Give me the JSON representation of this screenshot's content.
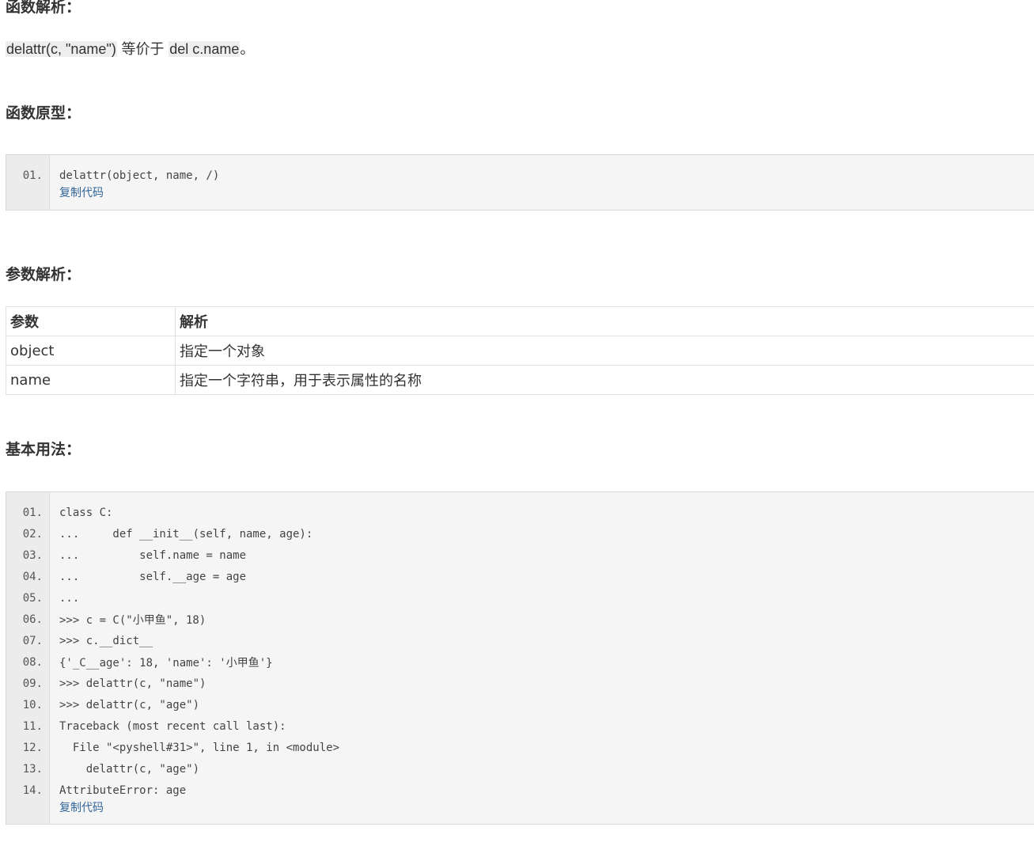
{
  "sections": {
    "analysis_heading": "函数解析：",
    "prototype_heading": "函数原型：",
    "params_heading": "参数解析：",
    "usage_heading": "基本用法："
  },
  "analysis": {
    "code1": "delattr(c, \"name\")",
    "middle": " 等价于 ",
    "code2": "del c.name",
    "end": "。"
  },
  "prototype_code": {
    "lines": [
      {
        "num": "01.",
        "text": "delattr(object, name, /)"
      }
    ],
    "copy_label": "复制代码"
  },
  "params_table": {
    "headers": [
      "参数",
      "解析"
    ],
    "rows": [
      [
        "object",
        "指定一个对象"
      ],
      [
        "name",
        "指定一个字符串，用于表示属性的名称"
      ]
    ]
  },
  "usage_code": {
    "lines": [
      {
        "num": "01.",
        "text": "class C:"
      },
      {
        "num": "02.",
        "text": "...     def __init__(self, name, age):"
      },
      {
        "num": "03.",
        "text": "...         self.name = name"
      },
      {
        "num": "04.",
        "text": "...         self.__age = age"
      },
      {
        "num": "05.",
        "text": "..."
      },
      {
        "num": "06.",
        "text": ">>> c = C(\"小甲鱼\", 18)"
      },
      {
        "num": "07.",
        "text": ">>> c.__dict__"
      },
      {
        "num": "08.",
        "text": "{'_C__age': 18, 'name': '小甲鱼'}"
      },
      {
        "num": "09.",
        "text": ">>> delattr(c, \"name\")"
      },
      {
        "num": "10.",
        "text": ">>> delattr(c, \"age\")"
      },
      {
        "num": "11.",
        "text": "Traceback (most recent call last):"
      },
      {
        "num": "12.",
        "text": "  File \"<pyshell#31>\", line 1, in <module>"
      },
      {
        "num": "13.",
        "text": "    delattr(c, \"age\")"
      },
      {
        "num": "14.",
        "text": "AttributeError: age"
      }
    ],
    "copy_label": "复制代码"
  }
}
